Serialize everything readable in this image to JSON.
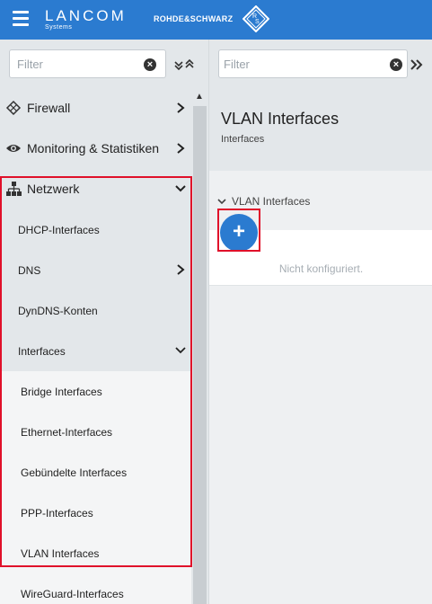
{
  "header": {
    "brand_name": "LANCOM",
    "brand_sub": "Systems",
    "partner_text": "ROHDE&SCHWARZ"
  },
  "left": {
    "filter_placeholder": "Filter",
    "nav": {
      "firewall": "Firewall",
      "monitoring": "Monitoring & Statistiken",
      "netzwerk": "Netzwerk",
      "dhcp": "DHCP-Interfaces",
      "dns": "DNS",
      "dyndns": "DynDNS-Konten",
      "interfaces": "Interfaces",
      "bridge": "Bridge Interfaces",
      "ethernet": "Ethernet-Interfaces",
      "gebuendelt": "Gebündelte Interfaces",
      "ppp": "PPP-Interfaces",
      "vlan": "VLAN Interfaces",
      "wireguard": "WireGuard-Interfaces"
    }
  },
  "right": {
    "filter_placeholder": "Filter",
    "title": "VLAN Interfaces",
    "breadcrumb": "Interfaces",
    "section_title": "VLAN Interfaces",
    "add_label": "+",
    "empty_text": "Nicht konfiguriert."
  }
}
